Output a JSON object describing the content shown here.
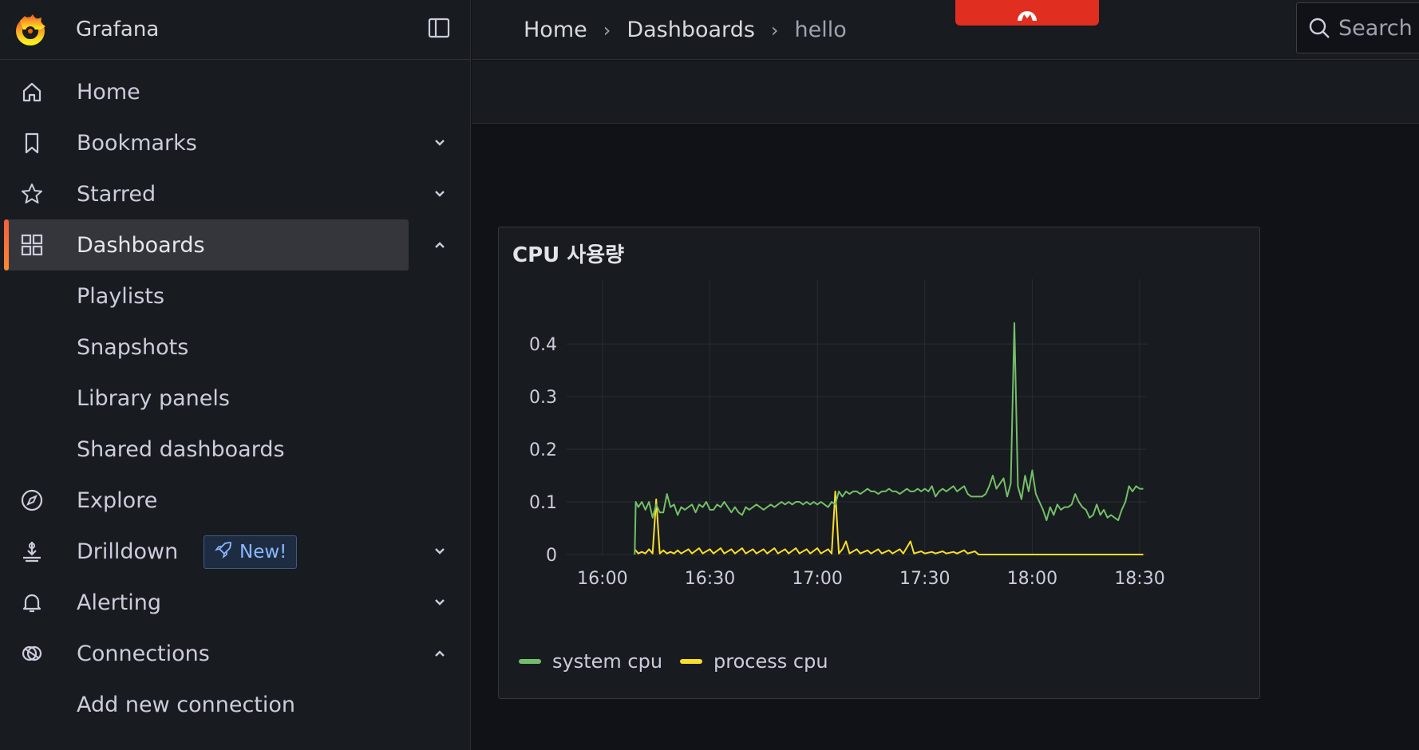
{
  "app": {
    "name": "Grafana"
  },
  "sidebar": {
    "items": [
      {
        "label": "Home",
        "icon": "home-icon"
      },
      {
        "label": "Bookmarks",
        "icon": "bookmark-icon",
        "chevron": "down"
      },
      {
        "label": "Starred",
        "icon": "star-icon",
        "chevron": "down"
      },
      {
        "label": "Dashboards",
        "icon": "apps-icon",
        "chevron": "up",
        "active": true
      },
      {
        "label": "Playlists",
        "sub": true
      },
      {
        "label": "Snapshots",
        "sub": true
      },
      {
        "label": "Library panels",
        "sub": true
      },
      {
        "label": "Shared dashboards",
        "sub": true
      },
      {
        "label": "Explore",
        "icon": "compass-icon"
      },
      {
        "label": "Drilldown",
        "icon": "drilldown-icon",
        "chevron": "down",
        "badge": "New!"
      },
      {
        "label": "Alerting",
        "icon": "bell-icon",
        "chevron": "down"
      },
      {
        "label": "Connections",
        "icon": "connections-icon",
        "chevron": "up"
      },
      {
        "label": "Add new connection",
        "sub": true
      }
    ]
  },
  "breadcrumb": {
    "items": [
      "Home",
      "Dashboards",
      "hello"
    ]
  },
  "search": {
    "placeholder": "Search"
  },
  "colors": {
    "accent": "#f46800",
    "system_cpu": "#73bf69",
    "process_cpu": "#fade2a",
    "badge": "#8ab8ff"
  },
  "panel": {
    "title": "CPU 사용량",
    "legend": [
      "system cpu",
      "process cpu"
    ]
  },
  "chart_data": {
    "type": "line",
    "title": "CPU 사용량",
    "x_ticks": [
      "16:00",
      "16:30",
      "17:00",
      "17:30",
      "18:00",
      "18:30"
    ],
    "y_ticks": [
      "0",
      "0.1",
      "0.2",
      "0.3",
      "0.4"
    ],
    "ylim": [
      0,
      0.47
    ],
    "xlim_minutes": [
      -7,
      45
    ],
    "grid": true,
    "legend_position": "bottom-left",
    "series": [
      {
        "name": "system cpu",
        "color": "#73bf69",
        "points": [
          [
            9.0,
            0.0
          ],
          [
            9.3,
            0.1
          ],
          [
            10,
            0.09
          ],
          [
            11,
            0.1
          ],
          [
            12,
            0.085
          ],
          [
            13,
            0.1
          ],
          [
            14,
            0.07
          ],
          [
            15,
            0.095
          ],
          [
            16,
            0.08
          ],
          [
            17,
            0.08
          ],
          [
            18,
            0.115
          ],
          [
            19,
            0.09
          ],
          [
            20,
            0.095
          ],
          [
            21,
            0.075
          ],
          [
            22,
            0.09
          ],
          [
            23,
            0.085
          ],
          [
            24,
            0.09
          ],
          [
            25,
            0.095
          ],
          [
            26,
            0.08
          ],
          [
            27,
            0.095
          ],
          [
            28,
            0.09
          ],
          [
            29,
            0.1
          ],
          [
            30,
            0.085
          ],
          [
            31,
            0.085
          ],
          [
            32,
            0.095
          ],
          [
            33,
            0.09
          ],
          [
            34,
            0.1
          ],
          [
            35,
            0.09
          ],
          [
            36,
            0.08
          ],
          [
            37,
            0.09
          ],
          [
            38,
            0.08
          ],
          [
            39,
            0.075
          ],
          [
            40,
            0.09
          ],
          [
            41,
            0.085
          ],
          [
            42,
            0.09
          ],
          [
            43,
            0.095
          ],
          [
            44,
            0.09
          ],
          [
            45,
            0.085
          ],
          [
            46,
            0.09
          ],
          [
            47,
            0.095
          ],
          [
            48,
            0.09
          ],
          [
            49,
            0.095
          ],
          [
            50,
            0.1
          ],
          [
            51,
            0.095
          ],
          [
            52,
            0.1
          ],
          [
            53,
            0.095
          ],
          [
            54,
            0.1
          ],
          [
            55,
            0.1
          ],
          [
            56,
            0.095
          ],
          [
            57,
            0.1
          ],
          [
            58,
            0.095
          ],
          [
            59,
            0.1
          ],
          [
            60,
            0.095
          ],
          [
            61,
            0.1
          ],
          [
            62,
            0.095
          ],
          [
            63,
            0.09
          ],
          [
            64,
            0.1
          ],
          [
            65,
            0.095
          ],
          [
            66,
            0.12
          ],
          [
            67,
            0.11
          ],
          [
            68,
            0.12
          ],
          [
            69,
            0.115
          ],
          [
            70,
            0.12
          ],
          [
            71,
            0.12
          ],
          [
            72,
            0.115
          ],
          [
            73,
            0.12
          ],
          [
            74,
            0.125
          ],
          [
            75,
            0.12
          ],
          [
            76,
            0.12
          ],
          [
            77,
            0.115
          ],
          [
            78,
            0.12
          ],
          [
            79,
            0.12
          ],
          [
            80,
            0.125
          ],
          [
            81,
            0.12
          ],
          [
            82,
            0.12
          ],
          [
            83,
            0.115
          ],
          [
            84,
            0.12
          ],
          [
            85,
            0.125
          ],
          [
            86,
            0.12
          ],
          [
            87,
            0.12
          ],
          [
            88,
            0.125
          ],
          [
            89,
            0.12
          ],
          [
            90,
            0.125
          ],
          [
            91,
            0.12
          ],
          [
            92,
            0.13
          ],
          [
            93,
            0.11
          ],
          [
            94,
            0.12
          ],
          [
            95,
            0.125
          ],
          [
            96,
            0.12
          ],
          [
            97,
            0.125
          ],
          [
            98,
            0.13
          ],
          [
            99,
            0.12
          ],
          [
            100,
            0.125
          ],
          [
            101,
            0.13
          ],
          [
            102,
            0.115
          ],
          [
            103,
            0.11
          ],
          [
            104,
            0.11
          ],
          [
            105,
            0.11
          ],
          [
            106,
            0.11
          ],
          [
            107,
            0.115
          ],
          [
            108,
            0.13
          ],
          [
            109,
            0.15
          ],
          [
            110,
            0.125
          ],
          [
            111,
            0.135
          ],
          [
            112,
            0.145
          ],
          [
            113,
            0.11
          ],
          [
            114,
            0.135
          ],
          [
            115,
            0.44
          ],
          [
            116,
            0.13
          ],
          [
            117,
            0.105
          ],
          [
            118,
            0.15
          ],
          [
            119,
            0.12
          ],
          [
            120,
            0.16
          ],
          [
            121,
            0.115
          ],
          [
            122,
            0.1
          ],
          [
            123,
            0.085
          ],
          [
            124,
            0.065
          ],
          [
            125,
            0.09
          ],
          [
            126,
            0.075
          ],
          [
            127,
            0.095
          ],
          [
            128,
            0.085
          ],
          [
            129,
            0.09
          ],
          [
            130,
            0.09
          ],
          [
            131,
            0.095
          ],
          [
            132,
            0.115
          ],
          [
            133,
            0.1
          ],
          [
            134,
            0.09
          ],
          [
            135,
            0.085
          ],
          [
            136,
            0.07
          ],
          [
            137,
            0.075
          ],
          [
            138,
            0.095
          ],
          [
            139,
            0.075
          ],
          [
            140,
            0.085
          ],
          [
            141,
            0.07
          ],
          [
            142,
            0.075
          ],
          [
            143,
            0.07
          ],
          [
            144,
            0.065
          ],
          [
            145,
            0.085
          ],
          [
            146,
            0.1
          ],
          [
            147,
            0.13
          ],
          [
            148,
            0.12
          ],
          [
            149,
            0.13
          ],
          [
            150,
            0.125
          ],
          [
            151,
            0.125
          ]
        ]
      },
      {
        "name": "process cpu",
        "color": "#fade2a",
        "points": [
          [
            9.0,
            0.01
          ],
          [
            10,
            0.002
          ],
          [
            11,
            0.005
          ],
          [
            12,
            0.002
          ],
          [
            13,
            0.01
          ],
          [
            14,
            0.002
          ],
          [
            15,
            0.105
          ],
          [
            16,
            0.002
          ],
          [
            17,
            0.008
          ],
          [
            18,
            0.002
          ],
          [
            19,
            0.005
          ],
          [
            20,
            0.002
          ],
          [
            21,
            0.008
          ],
          [
            22,
            0.002
          ],
          [
            24,
            0.01
          ],
          [
            25,
            0.002
          ],
          [
            27,
            0.012
          ],
          [
            28,
            0.002
          ],
          [
            30,
            0.01
          ],
          [
            31,
            0.002
          ],
          [
            33,
            0.012
          ],
          [
            34,
            0.002
          ],
          [
            36,
            0.01
          ],
          [
            37,
            0.002
          ],
          [
            39,
            0.012
          ],
          [
            40,
            0.002
          ],
          [
            42,
            0.01
          ],
          [
            43,
            0.002
          ],
          [
            45,
            0.01
          ],
          [
            46,
            0.002
          ],
          [
            48,
            0.012
          ],
          [
            49,
            0.002
          ],
          [
            51,
            0.01
          ],
          [
            52,
            0.002
          ],
          [
            54,
            0.012
          ],
          [
            55,
            0.002
          ],
          [
            57,
            0.01
          ],
          [
            58,
            0.002
          ],
          [
            60,
            0.012
          ],
          [
            61,
            0.002
          ],
          [
            63,
            0.01
          ],
          [
            64,
            0.002
          ],
          [
            65,
            0.12
          ],
          [
            66,
            0.002
          ],
          [
            67,
            0.01
          ],
          [
            68,
            0.025
          ],
          [
            69,
            0.002
          ],
          [
            71,
            0.01
          ],
          [
            72,
            0.002
          ],
          [
            74,
            0.008
          ],
          [
            75,
            0.002
          ],
          [
            77,
            0.01
          ],
          [
            78,
            0.002
          ],
          [
            80,
            0.008
          ],
          [
            81,
            0.002
          ],
          [
            83,
            0.01
          ],
          [
            84,
            0.002
          ],
          [
            86,
            0.025
          ],
          [
            87,
            0.002
          ],
          [
            89,
            0.006
          ],
          [
            90,
            0.002
          ],
          [
            92,
            0.005
          ],
          [
            93,
            0.002
          ],
          [
            95,
            0.006
          ],
          [
            96,
            0.002
          ],
          [
            98,
            0.005
          ],
          [
            99,
            0.002
          ],
          [
            101,
            0.008
          ],
          [
            102,
            0.002
          ],
          [
            104,
            0.006
          ],
          [
            105,
            0.0
          ],
          [
            151,
            0.0
          ]
        ]
      }
    ]
  }
}
